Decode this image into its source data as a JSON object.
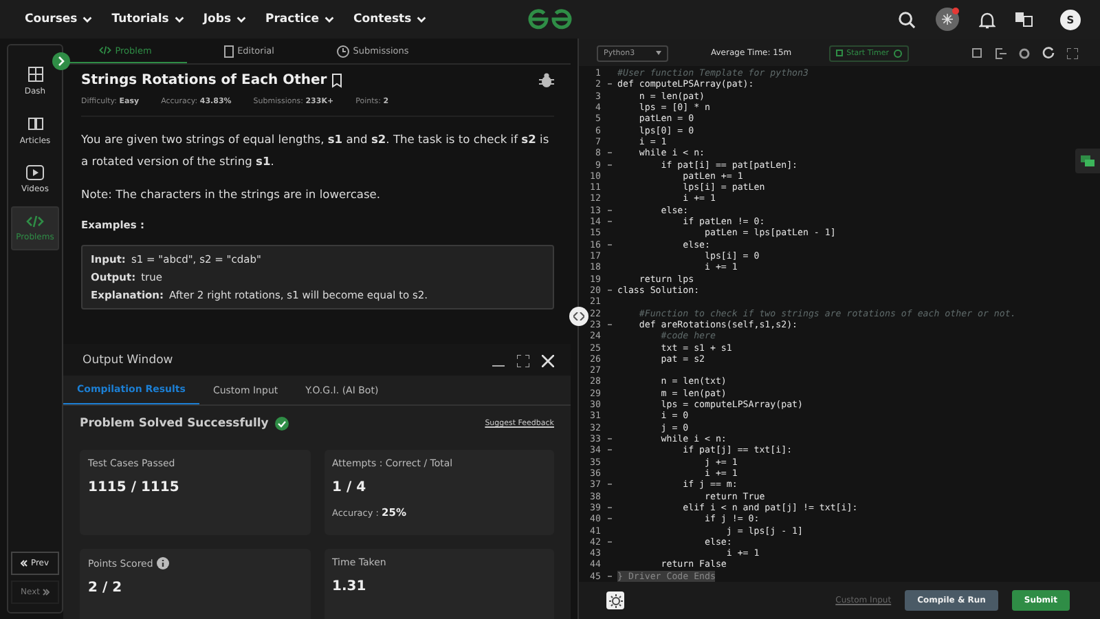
{
  "nav": {
    "menus": [
      "Courses",
      "Tutorials",
      "Jobs",
      "Practice",
      "Contests"
    ],
    "avatar": "S"
  },
  "sidebar": {
    "items": [
      {
        "label": "Dash",
        "selected": false
      },
      {
        "label": "Articles",
        "selected": false
      },
      {
        "label": "Videos",
        "selected": false
      },
      {
        "label": "Problems",
        "selected": true
      }
    ],
    "prev": "Prev",
    "next": "Next"
  },
  "tabs": [
    {
      "label": "Problem",
      "selected": true
    },
    {
      "label": "Editorial",
      "selected": false
    },
    {
      "label": "Submissions",
      "selected": false
    }
  ],
  "problem": {
    "title": "Strings Rotations of Each Other",
    "meta": [
      {
        "label": "Difficulty:",
        "value": "Easy"
      },
      {
        "label": "Accuracy:",
        "value": "43.83%"
      },
      {
        "label": "Submissions:",
        "value": "233K+"
      },
      {
        "label": "Points:",
        "value": "2"
      }
    ],
    "statement": "You are given two strings of equal lengths, **s1** and **s2**. The task is to check if **s2** is a rotated version of the string **s1**.",
    "note": "Note: The characters in the strings are in lowercase.",
    "examples_heading": "Examples :",
    "example": [
      {
        "label": "Input:",
        "value": "s1 = \"abcd\", s2 = \"cdab\""
      },
      {
        "label": "Output:",
        "value": "true"
      },
      {
        "label": "Explanation:",
        "value": "After 2 right rotations, s1 will become equal to s2."
      }
    ]
  },
  "output_window": {
    "title": "Output Window",
    "tabs": [
      {
        "label": "Compilation Results",
        "selected": true
      },
      {
        "label": "Custom Input",
        "selected": false
      },
      {
        "label": "Y.O.G.I. (AI Bot)",
        "selected": false
      }
    ],
    "status": "Problem Solved Successfully",
    "feedback": "Suggest Feedback",
    "cards": [
      {
        "label": "Test Cases Passed",
        "value": "1115 / 1115",
        "info": false
      },
      {
        "label": "Attempts : Correct / Total",
        "value": "1 / 4",
        "extra_label": "Accuracy :",
        "extra_value": "25%",
        "info": false
      },
      {
        "label": "Points Scored",
        "value": "2 / 2",
        "info": true
      },
      {
        "label": "Time Taken",
        "value": "1.31",
        "info": false
      }
    ]
  },
  "editor": {
    "language": "Python3",
    "average_time": "Average Time: 15m",
    "timer": "Start Timer",
    "lines": [
      {
        "n": "1",
        "text": "#User function Template for python3",
        "kind": "comment",
        "fold": false
      },
      {
        "n": "2",
        "text": "def computeLPSArray(pat):",
        "kind": "code",
        "fold": true
      },
      {
        "n": "3",
        "text": "    n = len(pat)",
        "kind": "code",
        "fold": false
      },
      {
        "n": "4",
        "text": "    lps = [0] * n",
        "kind": "code",
        "fold": false
      },
      {
        "n": "5",
        "text": "    patLen = 0",
        "kind": "code",
        "fold": false
      },
      {
        "n": "6",
        "text": "    lps[0] = 0",
        "kind": "code",
        "fold": false
      },
      {
        "n": "7",
        "text": "    i = 1",
        "kind": "code",
        "fold": false
      },
      {
        "n": "8",
        "text": "    while i < n:",
        "kind": "code",
        "fold": true
      },
      {
        "n": "9",
        "text": "        if pat[i] == pat[patLen]:",
        "kind": "code",
        "fold": true
      },
      {
        "n": "10",
        "text": "            patLen += 1",
        "kind": "code",
        "fold": false
      },
      {
        "n": "11",
        "text": "            lps[i] = patLen",
        "kind": "code",
        "fold": false
      },
      {
        "n": "12",
        "text": "            i += 1",
        "kind": "code",
        "fold": false
      },
      {
        "n": "13",
        "text": "        else:",
        "kind": "code",
        "fold": true
      },
      {
        "n": "14",
        "text": "            if patLen != 0:",
        "kind": "code",
        "fold": true
      },
      {
        "n": "15",
        "text": "                patLen = lps[patLen - 1]",
        "kind": "code",
        "fold": false
      },
      {
        "n": "16",
        "text": "            else:",
        "kind": "code",
        "fold": true
      },
      {
        "n": "17",
        "text": "                lps[i] = 0",
        "kind": "code",
        "fold": false
      },
      {
        "n": "18",
        "text": "                i += 1",
        "kind": "code",
        "fold": false
      },
      {
        "n": "19",
        "text": "    return lps",
        "kind": "code",
        "fold": false
      },
      {
        "n": "20",
        "text": "class Solution:",
        "kind": "code",
        "fold": true
      },
      {
        "n": "21",
        "fold": false
      },
      {
        "n": "22",
        "text": "    #Function to check if two strings are rotations of each other or not.",
        "kind": "comment",
        "fold": false
      },
      {
        "n": "23",
        "text": "    def areRotations(self,s1,s2):",
        "kind": "code",
        "fold": true
      },
      {
        "n": "24",
        "text": "        #code here",
        "kind": "comment",
        "fold": false
      },
      {
        "n": "25",
        "text": "        txt = s1 + s1",
        "kind": "code",
        "fold": false
      },
      {
        "n": "26",
        "text": "        pat = s2",
        "kind": "code",
        "fold": false
      },
      {
        "n": "27",
        "fold": false
      },
      {
        "n": "28",
        "text": "        n = len(txt)",
        "kind": "code",
        "fold": false
      },
      {
        "n": "29",
        "text": "        m = len(pat)",
        "kind": "code",
        "fold": false
      },
      {
        "n": "30",
        "text": "        lps = computeLPSArray(pat)",
        "kind": "code",
        "fold": false
      },
      {
        "n": "31",
        "text": "        i = 0",
        "kind": "code",
        "fold": false
      },
      {
        "n": "32",
        "text": "        j = 0",
        "kind": "code",
        "fold": false
      },
      {
        "n": "33",
        "text": "        while i < n:",
        "kind": "code",
        "fold": true
      },
      {
        "n": "34",
        "text": "            if pat[j] == txt[i]:",
        "kind": "code",
        "fold": true
      },
      {
        "n": "35",
        "text": "                j += 1",
        "kind": "code",
        "fold": false
      },
      {
        "n": "36",
        "text": "                i += 1",
        "kind": "code",
        "fold": false
      },
      {
        "n": "37",
        "text": "            if j == m:",
        "kind": "code",
        "fold": true
      },
      {
        "n": "38",
        "text": "                return True",
        "kind": "code",
        "fold": false
      },
      {
        "n": "39",
        "text": "            elif i < n and pat[j] != txt[i]:",
        "kind": "code",
        "fold": true
      },
      {
        "n": "40",
        "text": "                if j != 0:",
        "kind": "code",
        "fold": true
      },
      {
        "n": "41",
        "text": "                    j = lps[j - 1]",
        "kind": "code",
        "fold": false
      },
      {
        "n": "42",
        "text": "                else:",
        "kind": "code",
        "fold": true
      },
      {
        "n": "43",
        "text": "                    i += 1",
        "kind": "code",
        "fold": false
      },
      {
        "n": "44",
        "text": "        return False",
        "kind": "code",
        "fold": false
      },
      {
        "n": "45",
        "text": "} Driver Code Ends",
        "kind": "folded",
        "fold": true
      }
    ],
    "custom_input": "Custom Input",
    "compile": "Compile & Run",
    "submit": "Submit"
  }
}
